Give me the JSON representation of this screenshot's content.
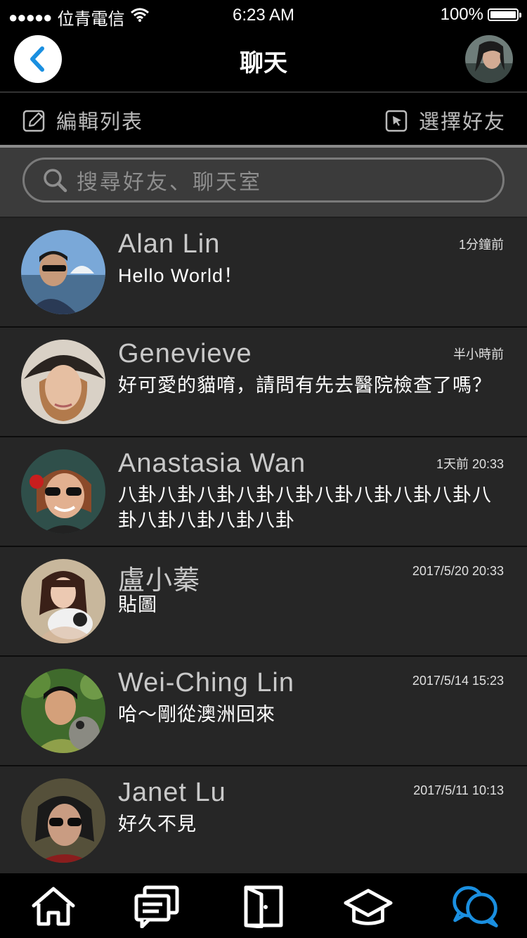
{
  "status_bar": {
    "signal": "●●●●●",
    "carrier": "位青電信",
    "time": "6:23 AM",
    "battery": "100%",
    "battery_level": 1.0
  },
  "nav": {
    "title": "聊天"
  },
  "toolbar": {
    "edit_label": "編輯列表",
    "select_label": "選擇好友"
  },
  "search": {
    "placeholder": "搜尋好友、聊天室"
  },
  "chats": [
    {
      "name": "Alan Lin",
      "time": "1分鐘前",
      "message": "Hello World！"
    },
    {
      "name": "Genevieve",
      "time": "半小時前",
      "message": "好可愛的貓唷，請問有先去醫院檢查了嗎？"
    },
    {
      "name": "Anastasia Wan",
      "time": "1天前 20:33",
      "message": "八卦八卦八卦八卦八卦八卦八卦八卦八卦八卦八卦八卦八卦八卦"
    },
    {
      "name": "盧小蓁",
      "time": "2017/5/20 20:33",
      "message": "貼圖"
    },
    {
      "name": "Wei-Ching Lin",
      "time": "2017/5/14 15:23",
      "message": "哈～剛從澳洲回來"
    },
    {
      "name": "Janet Lu",
      "time": "2017/5/11 10:13",
      "message": "好久不見"
    }
  ],
  "tabs": [
    {
      "icon": "home-icon",
      "active": false
    },
    {
      "icon": "messages-icon",
      "active": false
    },
    {
      "icon": "door-icon",
      "active": false
    },
    {
      "icon": "graduation-cap-icon",
      "active": false
    },
    {
      "icon": "chat-bubbles-icon",
      "active": true
    }
  ],
  "colors": {
    "accent": "#1a8fe0",
    "list_bg": "#262626",
    "search_bg": "#3b3b3b"
  }
}
